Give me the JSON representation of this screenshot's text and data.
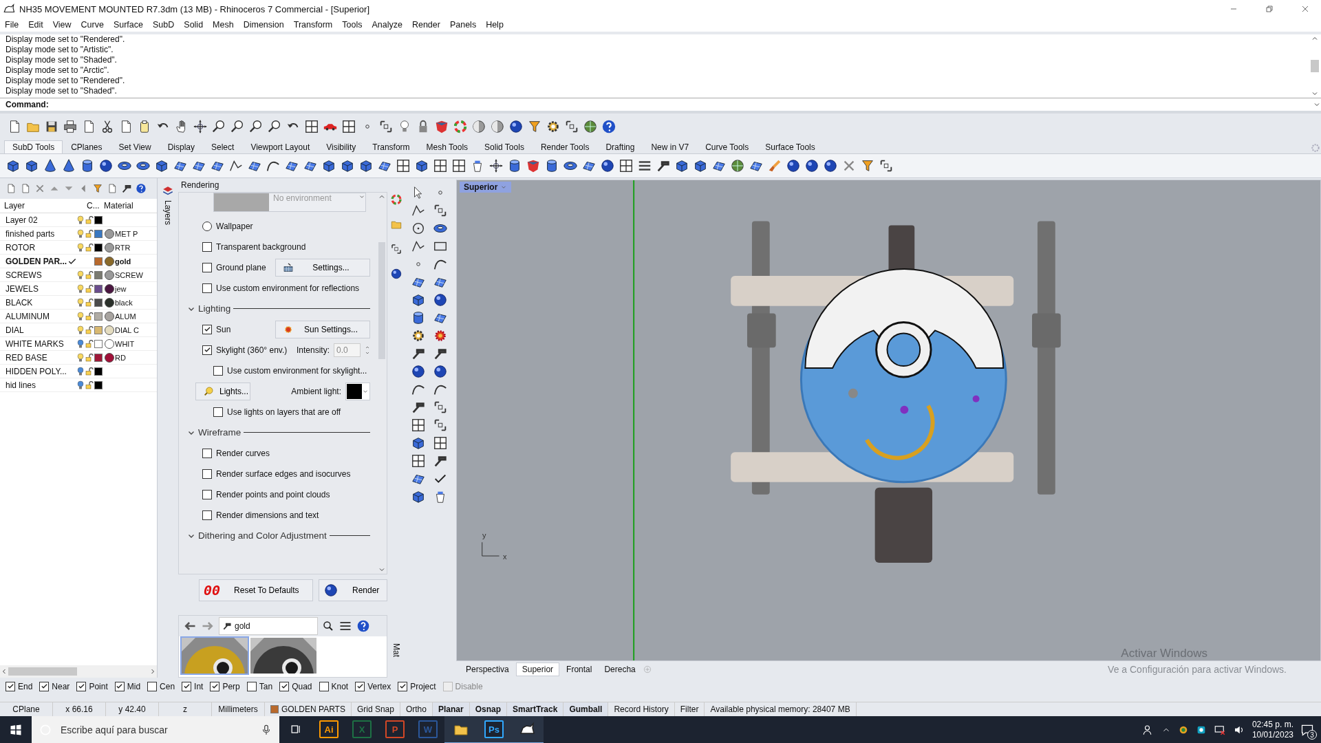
{
  "window": {
    "title": "NH35 MOVEMENT MOUNTED R7.3dm (13 MB) - Rhinoceros 7 Commercial - [Superior]"
  },
  "menu": [
    "File",
    "Edit",
    "View",
    "Curve",
    "Surface",
    "SubD",
    "Solid",
    "Mesh",
    "Dimension",
    "Transform",
    "Tools",
    "Analyze",
    "Render",
    "Panels",
    "Help"
  ],
  "command_history": [
    "Display mode set to \"Rendered\".",
    "Display mode set to \"Artistic\".",
    "Display mode set to \"Shaded\".",
    "Display mode set to \"Arctic\".",
    "Display mode set to \"Rendered\".",
    "Display mode set to \"Shaded\"."
  ],
  "command_prompt": "Command:",
  "toolbar_tabs": [
    {
      "label": "SubD Tools",
      "selected": true
    },
    {
      "label": "CPlanes",
      "selected": false
    },
    {
      "label": "Set View",
      "selected": false
    },
    {
      "label": "Display",
      "selected": false
    },
    {
      "label": "Select",
      "selected": false
    },
    {
      "label": "Viewport Layout",
      "selected": false
    },
    {
      "label": "Visibility",
      "selected": false
    },
    {
      "label": "Transform",
      "selected": false
    },
    {
      "label": "Mesh Tools",
      "selected": false
    },
    {
      "label": "Solid Tools",
      "selected": false
    },
    {
      "label": "Render Tools",
      "selected": false
    },
    {
      "label": "Drafting",
      "selected": false
    },
    {
      "label": "New in V7",
      "selected": false
    },
    {
      "label": "Curve Tools",
      "selected": false
    },
    {
      "label": "Surface Tools",
      "selected": false
    }
  ],
  "layers_panel": {
    "tab": "Layers",
    "columns": [
      "Layer",
      "C...",
      "Material"
    ],
    "layers": [
      {
        "name": "Layer 02",
        "current": false,
        "visible": true,
        "color": "#000000"
      },
      {
        "name": "finished parts",
        "current": false,
        "visible": true,
        "color": "#3a78c0",
        "material": {
          "name": "MET P",
          "color": "#9a9a9a"
        }
      },
      {
        "name": "ROTOR",
        "current": false,
        "visible": true,
        "color": "#000000",
        "material": {
          "name": "RTR",
          "color": "#9a9a9a"
        }
      },
      {
        "name": "GOLDEN PAR...",
        "current": true,
        "color": "#b8692c",
        "material": {
          "name": "gold",
          "color": "#8a6a2a"
        }
      },
      {
        "name": "SCREWS",
        "current": false,
        "visible": true,
        "color": "#7a7a70",
        "material": {
          "name": "SCREW",
          "color": "#9a9a9a"
        }
      },
      {
        "name": "JEWELS",
        "current": false,
        "visible": true,
        "color": "#6a4c8c",
        "material": {
          "name": "jew",
          "color": "#4a1640"
        }
      },
      {
        "name": "BLACK",
        "current": false,
        "visible": true,
        "color": "#4a4a4a",
        "material": {
          "name": "black",
          "color": "#2a302a"
        }
      },
      {
        "name": "ALUMINUM",
        "current": false,
        "visible": true,
        "color": "#b0aca4",
        "material": {
          "name": "ALUM",
          "color": "#a8a4a0"
        }
      },
      {
        "name": "DIAL",
        "current": false,
        "visible": true,
        "color": "#d8b870",
        "material": {
          "name": "DIAL C",
          "color": "#e4dcc0"
        }
      },
      {
        "name": "WHITE MARKS",
        "current": false,
        "visible": false,
        "color": "#ffffff",
        "material": {
          "name": "WHIT",
          "color": "#ffffff"
        }
      },
      {
        "name": "RED BASE",
        "current": false,
        "visible": true,
        "color": "#a01838",
        "material": {
          "name": "RD",
          "color": "#a01038"
        }
      },
      {
        "name": "HIDDEN POLY...",
        "current": false,
        "visible": false,
        "color": "#000000"
      },
      {
        "name": "hid lines",
        "current": false,
        "visible": false,
        "color": "#000000"
      }
    ]
  },
  "rendering": {
    "title": "Rendering",
    "environment": "No environment",
    "items": [
      {
        "kind": "radio",
        "label": "Wallpaper",
        "selected": false
      },
      {
        "kind": "checkbox",
        "label": "Transparent background",
        "checked": false
      },
      {
        "kind": "groundplane",
        "label": "Ground plane",
        "checked": false,
        "button": "Settings..."
      },
      {
        "kind": "checkbox",
        "label": "Use custom environment for reflections",
        "checked": false
      },
      {
        "kind": "section",
        "label": "Lighting",
        "expanded": true
      },
      {
        "kind": "sun",
        "label": "Sun",
        "checked": true,
        "button": "Sun Settings..."
      },
      {
        "kind": "skylight",
        "label": "Skylight (360° env.)",
        "checked": true,
        "field_label": "Intensity:",
        "field_value": "0.0"
      },
      {
        "kind": "subcheckbox",
        "label": "Use custom environment for skylight...",
        "checked": false
      },
      {
        "kind": "lights",
        "button": "Lights...",
        "color_label": "Ambient light:",
        "color": "#000000"
      },
      {
        "kind": "subcheckbox",
        "label": "Use lights on layers that are off",
        "checked": false
      },
      {
        "kind": "section",
        "label": "Wireframe",
        "expanded": true
      },
      {
        "kind": "checkbox",
        "label": "Render curves",
        "checked": false
      },
      {
        "kind": "checkbox",
        "label": "Render surface edges and isocurves",
        "checked": false
      },
      {
        "kind": "checkbox",
        "label": "Render points and point clouds",
        "checked": false
      },
      {
        "kind": "checkbox",
        "label": "Render dimensions and text",
        "checked": false
      },
      {
        "kind": "section",
        "label": "Dithering and Color Adjustment",
        "expanded": true
      }
    ],
    "buttons": [
      {
        "kind": "reset",
        "icon_text": "00",
        "label": "Reset To Defaults"
      },
      {
        "kind": "render",
        "label": "Render"
      }
    ]
  },
  "materials": {
    "tab": "Mat",
    "search": "gold",
    "thumbnails": [
      {
        "kind": "picture",
        "selected": true
      },
      {
        "kind": "picture",
        "selected": false
      }
    ]
  },
  "viewport": {
    "title": "Superior",
    "axis_labels": [
      "y",
      "x"
    ],
    "tabs": [
      {
        "label": "Perspectiva",
        "selected": false
      },
      {
        "label": "Superior",
        "selected": true
      },
      {
        "label": "Frontal",
        "selected": false
      },
      {
        "label": "Derecha",
        "selected": false
      }
    ],
    "activation_notice": {
      "title": "Activar Windows",
      "text": "Ve a Configuración para activar Windows."
    }
  },
  "osnaps": [
    {
      "label": "End",
      "checked": true,
      "disabled": false
    },
    {
      "label": "Near",
      "checked": true,
      "disabled": false
    },
    {
      "label": "Point",
      "checked": true,
      "disabled": false
    },
    {
      "label": "Mid",
      "checked": true,
      "disabled": false
    },
    {
      "label": "Cen",
      "checked": false,
      "disabled": false
    },
    {
      "label": "Int",
      "checked": true,
      "disabled": false
    },
    {
      "label": "Perp",
      "checked": true,
      "disabled": false
    },
    {
      "label": "Tan",
      "checked": false,
      "disabled": false
    },
    {
      "label": "Quad",
      "checked": true,
      "disabled": false
    },
    {
      "label": "Knot",
      "checked": false,
      "disabled": false
    },
    {
      "label": "Vertex",
      "checked": true,
      "disabled": false
    },
    {
      "label": "Project",
      "checked": true,
      "disabled": false
    },
    {
      "label": "Disable",
      "checked": false,
      "disabled": true
    }
  ],
  "status_bar": [
    {
      "kind": "text",
      "label": "CPlane"
    },
    {
      "kind": "text",
      "label": "x 66.16"
    },
    {
      "kind": "text",
      "label": "y 42.40"
    },
    {
      "kind": "text",
      "label": "z"
    },
    {
      "kind": "text",
      "label": "Millimeters"
    },
    {
      "kind": "layer",
      "label": "GOLDEN PARTS",
      "color": "#b8692c"
    },
    {
      "kind": "toggle",
      "label": "Grid Snap",
      "on": false
    },
    {
      "kind": "toggle",
      "label": "Ortho",
      "on": false
    },
    {
      "kind": "toggle",
      "label": "Planar",
      "on": true
    },
    {
      "kind": "toggle",
      "label": "Osnap",
      "on": true
    },
    {
      "kind": "toggle",
      "label": "SmartTrack",
      "on": true
    },
    {
      "kind": "toggle",
      "label": "Gumball",
      "on": true
    },
    {
      "kind": "toggle",
      "label": "Record History",
      "on": false
    },
    {
      "kind": "toggle",
      "label": "Filter",
      "on": false
    },
    {
      "kind": "memo",
      "label": "Available physical memory: 28407 MB"
    }
  ],
  "taskbar": {
    "search_placeholder": "Escribe aquí para buscar",
    "apps": [
      {
        "kind": "letter",
        "label": "Ai",
        "color": "#ff9a00",
        "running": false
      },
      {
        "kind": "letter",
        "label": "X",
        "color": "#1d7044",
        "running": false
      },
      {
        "kind": "letter",
        "label": "P",
        "color": "#d24726",
        "running": false
      },
      {
        "kind": "letter",
        "label": "W",
        "color": "#2b579a",
        "running": false
      },
      {
        "kind": "folder",
        "running": true
      },
      {
        "kind": "letter",
        "label": "Ps",
        "color": "#31a8ff",
        "running": true
      },
      {
        "kind": "rhino",
        "running": true
      }
    ],
    "time": "02:45 p. m.",
    "date": "10/01/2023",
    "notifications": "3"
  }
}
